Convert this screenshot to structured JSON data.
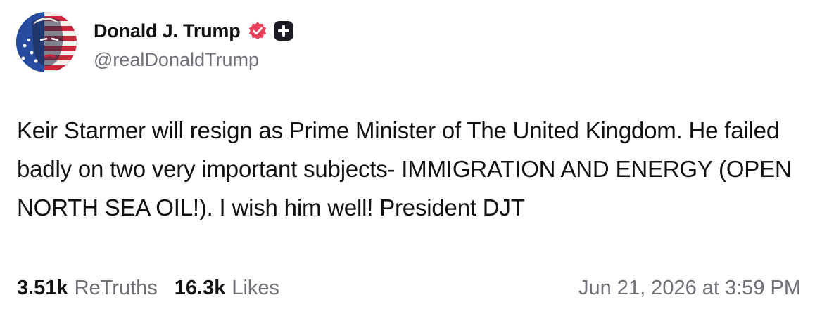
{
  "author": {
    "display_name": "Donald J. Trump",
    "handle": "@realDonaldTrump",
    "avatar_icon": "avatar-flag-portrait",
    "verified_icon": "verified-badge-icon",
    "plus_icon": "plus-badge-icon"
  },
  "post": {
    "text": "Keir Starmer will resign as Prime Minister of The United Kingdom. He failed badly on two very important subjects- IMMIGRATION AND ENERGY (OPEN NORTH SEA OIL!). I wish him well! President DJT"
  },
  "stats": {
    "retruths_count": "3.51k",
    "retruths_label": "ReTruths",
    "likes_count": "16.3k",
    "likes_label": "Likes"
  },
  "timestamp": "Jun 21, 2026 at 3:59 PM",
  "colors": {
    "verified_badge": "#e8405a",
    "plus_badge": "#1c1c24",
    "secondary_text": "#707078",
    "primary_text": "#111111"
  }
}
